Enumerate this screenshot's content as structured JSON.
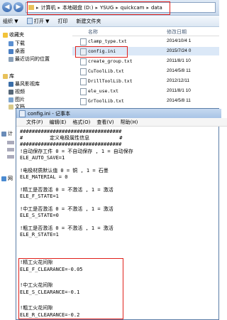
{
  "explorer": {
    "address": [
      "计算机",
      "本地磁盘 (D:)",
      "YSUG",
      "quickcam",
      "data"
    ],
    "toolbar": {
      "organize": "组织 ▼",
      "open": "打开 ▼",
      "print": "打印",
      "new_folder": "新建文件夹"
    },
    "sidebar": {
      "favorites": "收藏夹",
      "downloads": "下载",
      "desktop": "桌面",
      "recent": "最近访问的位置",
      "libraries": "库",
      "storm": "暴风影视库",
      "videos": "视频",
      "pictures": "图片",
      "docs": "文档",
      "computer": "计",
      "network": "网"
    },
    "columns": {
      "name": "名称",
      "modified": "修改日期"
    },
    "files": [
      {
        "name": "clamp_type.txt",
        "date": "2014/10/4 1"
      },
      {
        "name": "config.ini",
        "date": "2015/7/24 0"
      },
      {
        "name": "create_group.txt",
        "date": "2011/8/1 10"
      },
      {
        "name": "CuToolLib.txt",
        "date": "2014/5/8 11"
      },
      {
        "name": "DrillToolLib.txt",
        "date": "2012/12/11"
      },
      {
        "name": "ele_use.txt",
        "date": "2011/8/1 10"
      },
      {
        "name": "GrToolLib.txt",
        "date": "2014/5/8 11"
      }
    ]
  },
  "notepad": {
    "title": "config.ini - 记事本",
    "menu": [
      "文件(F)",
      "编辑(E)",
      "格式(O)",
      "查看(V)",
      "帮助(H)"
    ],
    "lines": [
      "##################################",
      "#         定义电极属性信息          #",
      "##################################",
      "!自动保存工件 0 = 不自动保存 , 1 = 自动保存",
      "ELE_AUTO_SAVE=1",
      "",
      "!电极材质默认值 0 = 铜 , 1 = 石墨",
      "ELE_MATERIAL = 0",
      "",
      "!精工是否激活 0 = 不激活 , 1 = 激活",
      "ELE_F_STATE=1",
      "",
      "!中工是否激活 0 = 不激活 , 1 = 激活",
      "ELE_S_STATE=0",
      "",
      "!粗工是否激活 0 = 不激活 , 1 = 激活",
      "ELE_R_STATE=1",
      "",
      "!精工火花间隙",
      "ELE_F_CLEARANCE=-0.05",
      "",
      "!中工火花间隙",
      "ELE_S_CLEARANCE=-0.1",
      "",
      "!粗工火花间隙",
      "ELE_R_CLEARANCE=-0.2"
    ]
  },
  "colors": {
    "highlight": "#e0201b",
    "folder": "#e8c15a"
  }
}
